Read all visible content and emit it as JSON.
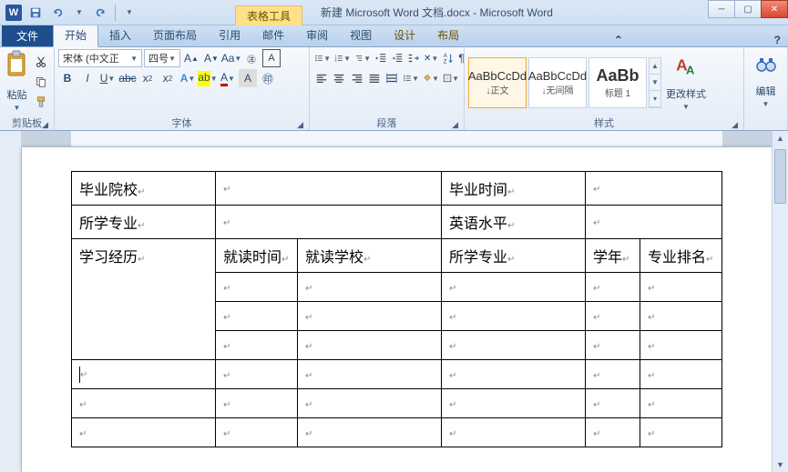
{
  "titlebar": {
    "app_icon_text": "W",
    "doc_title": "新建 Microsoft Word 文档.docx - Microsoft Word",
    "contextual_label": "表格工具"
  },
  "tabs": {
    "file": "文件",
    "home": "开始",
    "insert": "插入",
    "layout": "页面布局",
    "references": "引用",
    "mail": "邮件",
    "review": "审阅",
    "view": "视图",
    "design": "设计",
    "table_layout": "布局"
  },
  "ribbon": {
    "clipboard": {
      "label": "剪贴板",
      "paste": "粘贴"
    },
    "font": {
      "label": "字体",
      "font_name": "宋体 (中文正",
      "font_size": "四号"
    },
    "paragraph": {
      "label": "段落"
    },
    "styles": {
      "label": "样式",
      "items": [
        {
          "preview": "AaBbCcDd",
          "name": "↓正文"
        },
        {
          "preview": "AaBbCcDd",
          "name": "↓无间隔"
        },
        {
          "preview": "AaBb",
          "name": "标题 1"
        }
      ],
      "change": "更改样式"
    },
    "editing": {
      "label": "编辑"
    }
  },
  "table": {
    "r1c1": "毕业院校",
    "r1c3": "毕业时间",
    "r2c1": "所学专业",
    "r2c3": "英语水平",
    "r3c1": "学习经历",
    "r3c2": "就读时间",
    "r3c3": "就读学校",
    "r3c4": "所学专业",
    "r3c5": "学年",
    "r3c6": "专业排名"
  }
}
